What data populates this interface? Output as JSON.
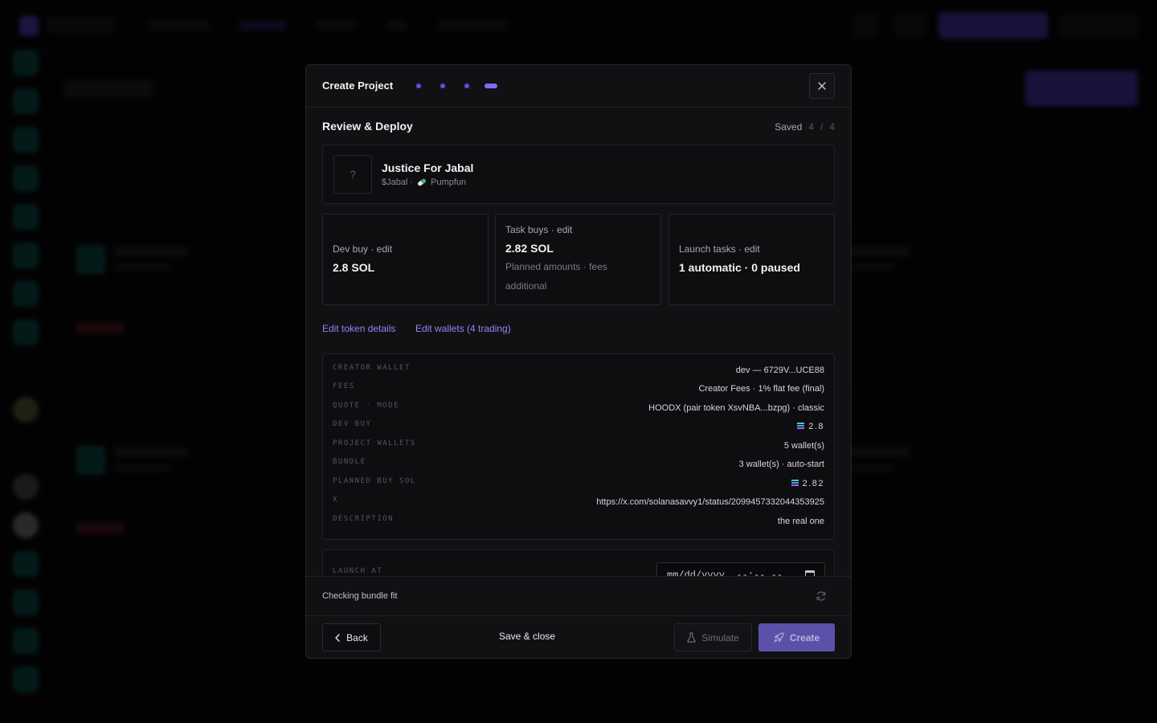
{
  "modal": {
    "title": "Create Project",
    "steps_total": 4,
    "active_step": 4
  },
  "section": {
    "title": "Review & Deploy",
    "saved_label": "Saved",
    "step_current": "4",
    "step_sep": "/",
    "step_total": "4"
  },
  "token": {
    "image_placeholder": "?",
    "name": "Justice For Jabal",
    "ticker": "$Jabal ·",
    "platform": "Pumpfun"
  },
  "stats": {
    "dev_buy": {
      "label": "Dev buy · edit",
      "value": "2.8 SOL"
    },
    "task_buys": {
      "label": "Task buys · edit",
      "value": "2.82 SOL",
      "sub": "Planned amounts · fees additional"
    },
    "launch_tasks": {
      "label": "Launch tasks · edit",
      "value": "1 automatic · 0 paused"
    }
  },
  "links": {
    "edit_token": "Edit token details",
    "edit_wallets": "Edit wallets (4 trading)"
  },
  "details": [
    {
      "key": "CREATOR WALLET",
      "value": "dev — 6729V...UCE88",
      "sol": false
    },
    {
      "key": "FEES",
      "value": "Creator Fees · 1% flat fee (final)",
      "sol": false
    },
    {
      "key": "QUOTE · MODE",
      "value": "HOODX (pair token XsvNBA...bzpg) · classic",
      "sol": false
    },
    {
      "key": "DEV BUY",
      "value": "2.8",
      "sol": true
    },
    {
      "key": "PROJECT WALLETS",
      "value": "5 wallet(s)",
      "sol": false
    },
    {
      "key": "BUNDLE",
      "value": "3 wallet(s) · auto-start",
      "sol": false
    },
    {
      "key": "PLANNED BUY SOL",
      "value": "2.82",
      "sol": true
    },
    {
      "key": "X",
      "value": "https://x.com/solanasavvy1/status/2099457332044353925",
      "sol": false
    },
    {
      "key": "DESCRIPTION",
      "value": "the real one",
      "sol": false
    }
  ],
  "launch": {
    "label": "LAUNCH AT",
    "placeholder": "mm/dd/yyyy, --:-- --"
  },
  "status": {
    "text": "Checking bundle fit"
  },
  "footer": {
    "back": "Back",
    "save_close": "Save & close",
    "simulate": "Simulate",
    "create": "Create"
  },
  "colors": {
    "accent": "#7c6cf5",
    "link": "#8f86f5",
    "create_disabled": "#5c51a8"
  }
}
